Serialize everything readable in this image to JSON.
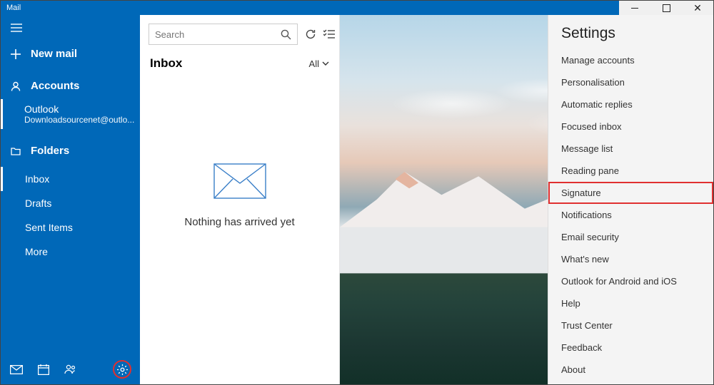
{
  "window": {
    "title": "Mail"
  },
  "sidebar": {
    "newmail": "New mail",
    "accounts_label": "Accounts",
    "account": {
      "name": "Outlook",
      "email": "Downloadsourcenet@outlo..."
    },
    "folders_label": "Folders",
    "folders": {
      "inbox": "Inbox",
      "drafts": "Drafts",
      "sent": "Sent Items",
      "more": "More"
    }
  },
  "inbox": {
    "search_placeholder": "Search",
    "title": "Inbox",
    "filter": "All",
    "empty_message": "Nothing has arrived yet"
  },
  "settings": {
    "title": "Settings",
    "items": {
      "manage": "Manage accounts",
      "personal": "Personalisation",
      "autoreply": "Automatic replies",
      "focused": "Focused inbox",
      "msglist": "Message list",
      "reading": "Reading pane",
      "signature": "Signature",
      "notif": "Notifications",
      "emailsec": "Email security",
      "whatsnew": "What's new",
      "outlookmob": "Outlook for Android and iOS",
      "help": "Help",
      "trust": "Trust Center",
      "feedback": "Feedback",
      "about": "About"
    }
  }
}
